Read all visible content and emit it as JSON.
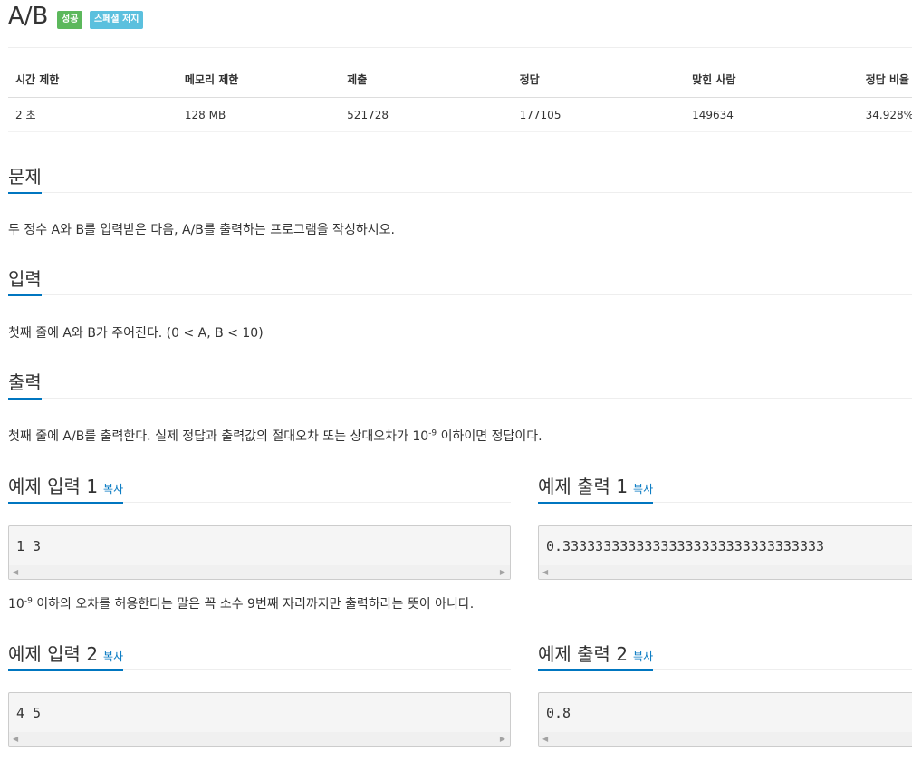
{
  "problem": {
    "title": "A/B",
    "labels": {
      "success": "성공",
      "special": "스페셜 저지"
    }
  },
  "info_table": {
    "headers": [
      "시간 제한",
      "메모리 제한",
      "제출",
      "정답",
      "맞힌 사람",
      "정답 비율"
    ],
    "values": [
      "2 초",
      "128 MB",
      "521728",
      "177105",
      "149634",
      "34.928%"
    ]
  },
  "sections": {
    "description": {
      "title": "문제",
      "text": "두 정수 A와 B를 입력받은 다음, A/B를 출력하는 프로그램을 작성하시오."
    },
    "input": {
      "title": "입력",
      "text": "첫째 줄에 A와 B가 주어진다. (0 < A, B < 10)"
    },
    "output": {
      "title": "출력",
      "text_before": "첫째 줄에 A/B를 출력한다. 실제 정답과 출력값의 절대오차 또는 상대오차가 10",
      "text_sup": "-9",
      "text_after": " 이하이면 정답이다."
    }
  },
  "samples": {
    "copy_label": "복사",
    "input1": {
      "title": "예제 입력 1",
      "value": "1 3"
    },
    "output1": {
      "title": "예제 출력 1",
      "value": "0.33333333333333333333333333333333"
    },
    "note": {
      "before": "10",
      "sup": "-9",
      "after": " 이하의 오차를 허용한다는 말은 꼭 소수 9번째 자리까지만 출력하라는 뜻이 아니다."
    },
    "input2": {
      "title": "예제 입력 2",
      "value": "4 5"
    },
    "output2": {
      "title": "예제 출력 2",
      "value": "0.8"
    }
  },
  "colors": {
    "accent": "#0076c0",
    "success": "#5cb85c",
    "info": "#5bc0de"
  }
}
